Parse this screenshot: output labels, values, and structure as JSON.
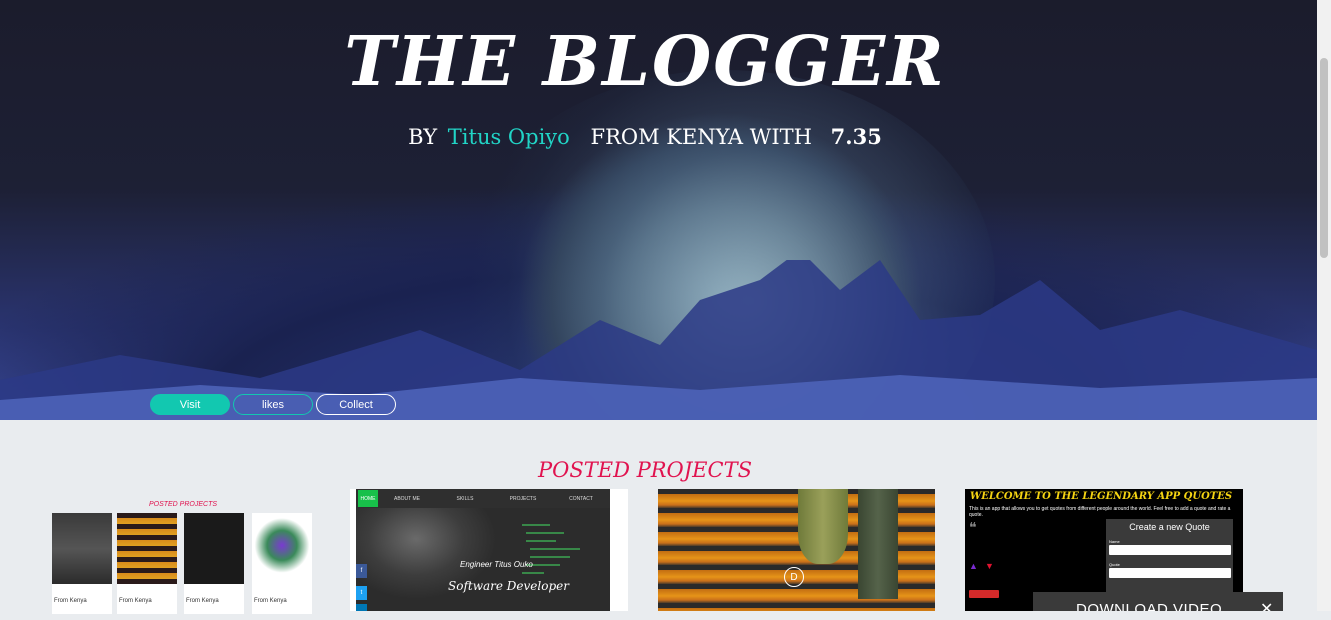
{
  "hero": {
    "title": "THE BLOGGER",
    "by": "BY",
    "author": "Titus Opiyo",
    "from": "FROM KENYA WITH",
    "score": "7.35",
    "buttons": {
      "visit": "Visit",
      "likes": "likes",
      "collect": "Collect"
    }
  },
  "section": {
    "title": "POSTED PROJECTS"
  },
  "card1": {
    "title": "POSTED PROJECTS",
    "captions": [
      "From Kenya",
      "From Kenya",
      "From Kenya",
      "From Kenya"
    ]
  },
  "card2": {
    "nav": [
      "HOME",
      "ABOUT ME",
      "SKILLS",
      "PROJECTS",
      "CONTACT"
    ],
    "engineer": "Engineer Titus Ouko",
    "role": "Software Developer"
  },
  "card3": {
    "play_letter": "D"
  },
  "card4": {
    "title": "WELCOME TO THE LEGENDARY APP QUOTES",
    "description": "This is an app that allows you to get quotes from different people around the world. Feel free to add a quote and rate a quote.",
    "form_title": "Create a new Quote",
    "name_label": "Name",
    "quote_label": "Quote"
  },
  "download": {
    "label": "DOWNLOAD VIDEO",
    "close": "✕"
  },
  "colors": {
    "accent_teal": "#21d4c6",
    "accent_pink": "#e0134f",
    "quote_yellow": "#f5d412"
  }
}
